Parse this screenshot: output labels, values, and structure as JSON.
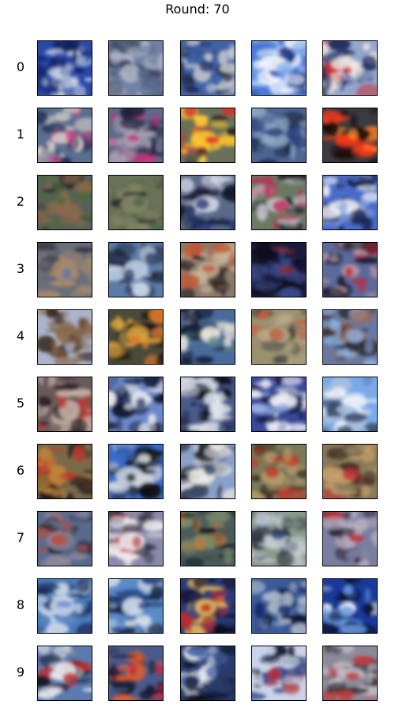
{
  "title": "Round: 70",
  "row_labels": [
    "0",
    "1",
    "2",
    "3",
    "4",
    "5",
    "6",
    "7",
    "8",
    "9"
  ],
  "grid": {
    "rows": [
      [
        {
          "bg": "#2a47a8",
          "mid": "#c8d4e6",
          "accent": "#7a8fb8",
          "dark": "#0d1f5c"
        },
        {
          "bg": "#7080a6",
          "mid": "#b2b8c8",
          "accent": "#5a6c8e",
          "dark": "#3a4460"
        },
        {
          "bg": "#4062a6",
          "mid": "#c8cad0",
          "accent": "#2a3c70",
          "dark": "#181c30"
        },
        {
          "bg": "#4a7ad8",
          "mid": "#ffffff",
          "accent": "#8fb4ee",
          "dark": "#1a3a88"
        },
        {
          "bg": "#94a6cc",
          "mid": "#f0e8e0",
          "accent": "#d02828",
          "dark": "#1a2a5a"
        }
      ],
      [
        {
          "bg": "#5a6e90",
          "mid": "#d8d0c8",
          "accent": "#d03a8a",
          "dark": "#1e2a50"
        },
        {
          "bg": "#5c6a88",
          "mid": "#a8a0b0",
          "accent": "#d02a7a",
          "dark": "#221c3c"
        },
        {
          "bg": "#6a7058",
          "mid": "#ffcc30",
          "accent": "#e02a2a",
          "dark": "#1a1a20"
        },
        {
          "bg": "#4e6492",
          "mid": "#90a8c8",
          "accent": "#2a3e7a",
          "dark": "#141c34"
        },
        {
          "bg": "#3a3a40",
          "mid": "#f03a1a",
          "accent": "#ff8a2a",
          "dark": "#1a1010"
        }
      ],
      [
        {
          "bg": "#5a6058",
          "mid": "#8a6a4a",
          "accent": "#4a6a3a",
          "dark": "#1a1a22"
        },
        {
          "bg": "#6a7256",
          "mid": "#8a8a6a",
          "accent": "#4a6a4a",
          "dark": "#2a2a2e"
        },
        {
          "bg": "#5a6a8a",
          "mid": "#d8dcea",
          "accent": "#2a3a7a",
          "dark": "#101428"
        },
        {
          "bg": "#6a7a62",
          "mid": "#c8c8d0",
          "accent": "#c02a5a",
          "dark": "#181a28"
        },
        {
          "bg": "#4a6cc8",
          "mid": "#f4f4fa",
          "accent": "#8ea8dc",
          "dark": "#121a40"
        }
      ],
      [
        {
          "bg": "#6a6e7a",
          "mid": "#a88a6a",
          "accent": "#5a7aa8",
          "dark": "#2a2a30"
        },
        {
          "bg": "#5a7aa8",
          "mid": "#c8d8ea",
          "accent": "#3a4a70",
          "dark": "#1c2030"
        },
        {
          "bg": "#8a7a6a",
          "mid": "#c8b498",
          "accent": "#c05a3a",
          "dark": "#2a2020"
        },
        {
          "bg": "#1a1a3a",
          "mid": "#3a4a8a",
          "accent": "#8a2a3a",
          "dark": "#0a0a1a"
        },
        {
          "bg": "#5a6a9a",
          "mid": "#c09aa0",
          "accent": "#c02a3a",
          "dark": "#1a1a2e"
        }
      ],
      [
        {
          "bg": "#aab4ca",
          "mid": "#8a6a4a",
          "accent": "#6a4a3a",
          "dark": "#3a2a20"
        },
        {
          "bg": "#4a4a3a",
          "mid": "#d8a03a",
          "accent": "#e07a2a",
          "dark": "#1a1412"
        },
        {
          "bg": "#4a6a9a",
          "mid": "#e8e4d8",
          "accent": "#5a8a8a",
          "dark": "#101830"
        },
        {
          "bg": "#9a9070",
          "mid": "#b8a888",
          "accent": "#c06040",
          "dark": "#4a4a40"
        },
        {
          "bg": "#6a78a0",
          "mid": "#9a6a5a",
          "accent": "#8ab0e0",
          "dark": "#2a2020"
        }
      ],
      [
        {
          "bg": "#6a5a5a",
          "mid": "#c8b4a8",
          "accent": "#c03a3a",
          "dark": "#2a2028"
        },
        {
          "bg": "#6a88c8",
          "mid": "#f0f0f4",
          "accent": "#3a4a7a",
          "dark": "#101830"
        },
        {
          "bg": "#4a5a8a",
          "mid": "#e0e4ea",
          "accent": "#2a3a6a",
          "dark": "#0c1020"
        },
        {
          "bg": "#3a4a9a",
          "mid": "#f4f4fa",
          "accent": "#8aa8e0",
          "dark": "#101840"
        },
        {
          "bg": "#7aa8e8",
          "mid": "#f4f8fc",
          "accent": "#b0c4dc",
          "dark": "#3a4a6a"
        }
      ],
      [
        {
          "bg": "#7a6a4a",
          "mid": "#c88a3a",
          "accent": "#c03a2a",
          "dark": "#1a1818"
        },
        {
          "bg": "#3a6ac8",
          "mid": "#d0d4da",
          "accent": "#2a2a2a",
          "dark": "#0c0c10"
        },
        {
          "bg": "#8aa0c8",
          "mid": "#f0eee8",
          "accent": "#3a4a6a",
          "dark": "#1c1c28"
        },
        {
          "bg": "#7a7a5a",
          "mid": "#b89a6a",
          "accent": "#c03a2a",
          "dark": "#3a3020"
        },
        {
          "bg": "#8a7a5a",
          "mid": "#c8a06a",
          "accent": "#c0303a",
          "dark": "#3a2a20"
        }
      ],
      [
        {
          "bg": "#5a6a8a",
          "mid": "#8a8a9a",
          "accent": "#c04a3a",
          "dark": "#12182a"
        },
        {
          "bg": "#8a8aaa",
          "mid": "#f0ecf0",
          "accent": "#c05a5a",
          "dark": "#2a2a38"
        },
        {
          "bg": "#4a5a5a",
          "mid": "#7a8a6a",
          "accent": "#c07a3a",
          "dark": "#141a22"
        },
        {
          "bg": "#8a9a8a",
          "mid": "#c8d0d8",
          "accent": "#2a4a8a",
          "dark": "#2a3040"
        },
        {
          "bg": "#7a7ea0",
          "mid": "#b8b0c0",
          "accent": "#c02a2a",
          "dark": "#201a28"
        }
      ],
      [
        {
          "bg": "#4a7ab8",
          "mid": "#c8d8ea",
          "accent": "#6a8ac8",
          "dark": "#1c2a5a"
        },
        {
          "bg": "#5a8ac8",
          "mid": "#d8e4ee",
          "accent": "#2a4a8a",
          "dark": "#142040"
        },
        {
          "bg": "#2a3a7a",
          "mid": "#f0c05a",
          "accent": "#c02a2a",
          "dark": "#0c1020"
        },
        {
          "bg": "#3a5a9a",
          "mid": "#aab8cc",
          "accent": "#1a2a6a",
          "dark": "#0c1428"
        },
        {
          "bg": "#1a3a9a",
          "mid": "#ffffff",
          "accent": "#6a9ae0",
          "dark": "#081840"
        }
      ],
      [
        {
          "bg": "#5a7ab0",
          "mid": "#e8e8ec",
          "accent": "#c02a2a",
          "dark": "#121828"
        },
        {
          "bg": "#4a5a8a",
          "mid": "#e0602a",
          "accent": "#c02a4a",
          "dark": "#141a30"
        },
        {
          "bg": "#2a3a6a",
          "mid": "#e8eaf0",
          "accent": "#4a6aaa",
          "dark": "#080c1a"
        },
        {
          "bg": "#c8d4ea",
          "mid": "#3a4a8a",
          "accent": "#c02a2a",
          "dark": "#1a1a30"
        },
        {
          "bg": "#8a8a9a",
          "mid": "#c8c0c8",
          "accent": "#c03a3a",
          "dark": "#2a2a30"
        }
      ]
    ]
  }
}
